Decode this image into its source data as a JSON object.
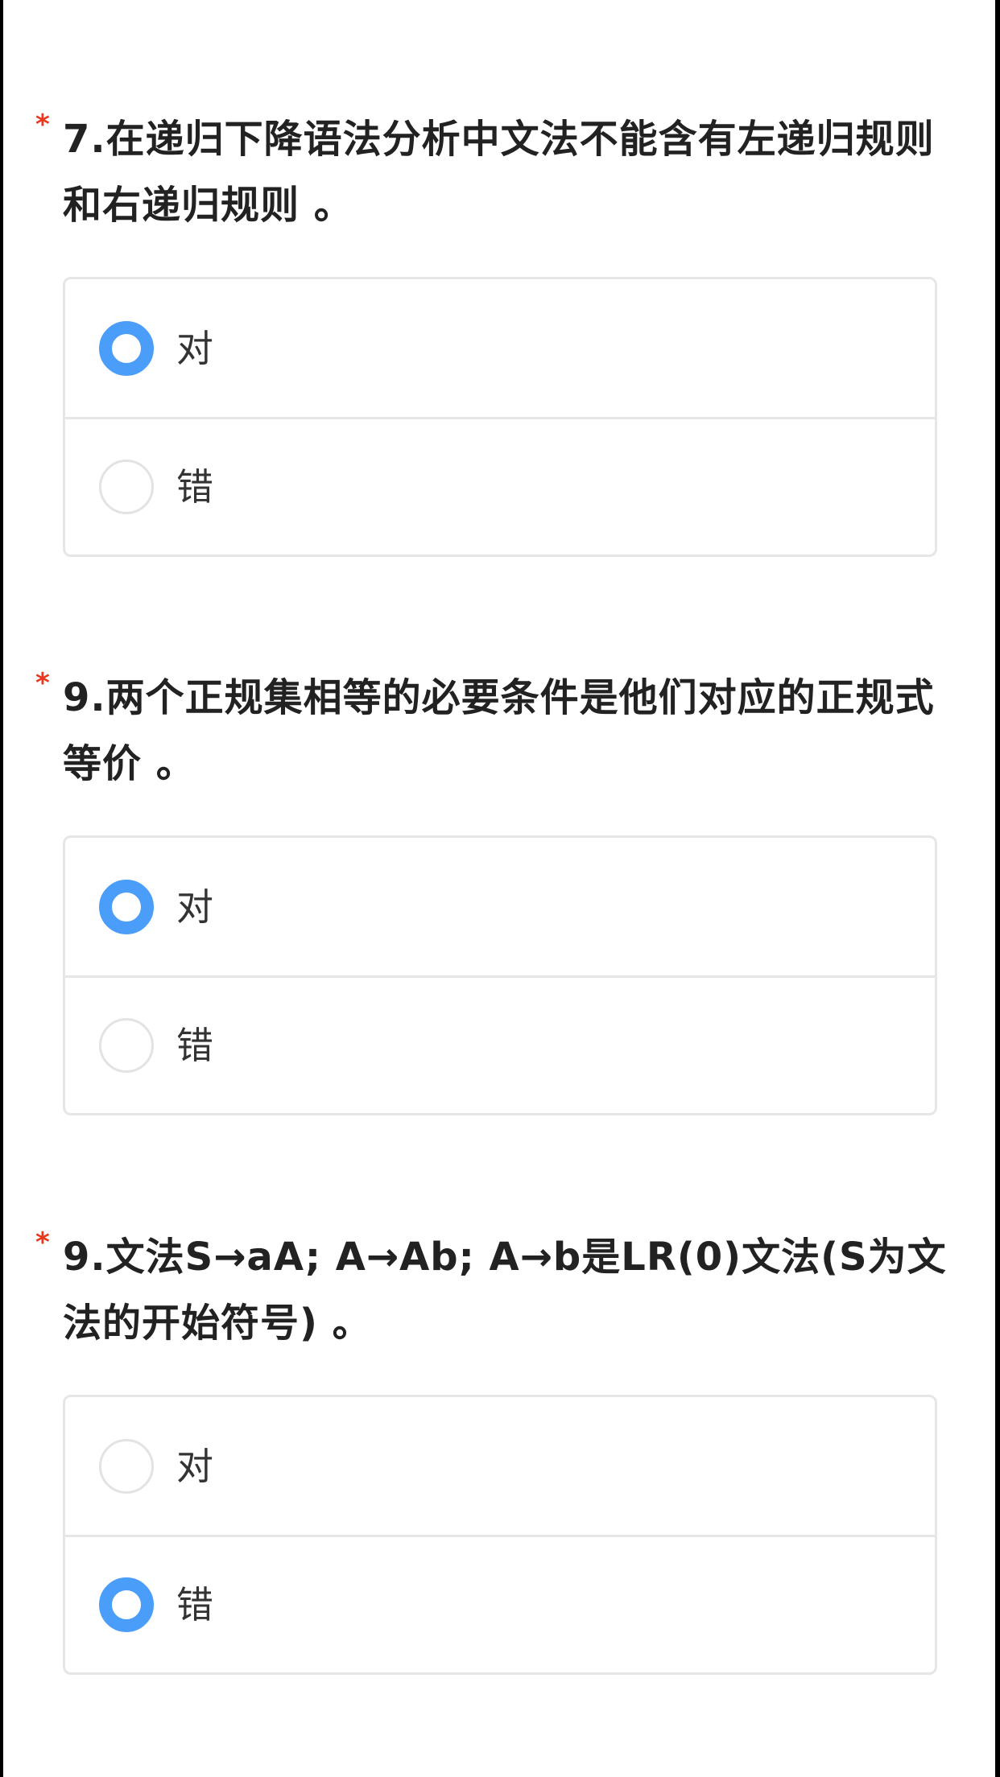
{
  "questions": [
    {
      "required_mark": "*",
      "title": "7.在递归下降语法分析中文法不能含有左递归规则和右递归规则 。",
      "options": [
        {
          "label": "对",
          "selected": true
        },
        {
          "label": "错",
          "selected": false
        }
      ]
    },
    {
      "required_mark": "*",
      "title": "9.两个正规集相等的必要条件是他们对应的正规式等价 。",
      "options": [
        {
          "label": "对",
          "selected": true
        },
        {
          "label": "错",
          "selected": false
        }
      ]
    },
    {
      "required_mark": "*",
      "title": "9.文法S→aA; A→Ab; A→b是LR(0)文法(S为文法的开始符号) 。",
      "options": [
        {
          "label": "对",
          "selected": false
        },
        {
          "label": "错",
          "selected": true
        }
      ]
    }
  ],
  "colors": {
    "accent": "#4a9df8",
    "required": "#e8391e",
    "border": "#e6e6e6"
  }
}
